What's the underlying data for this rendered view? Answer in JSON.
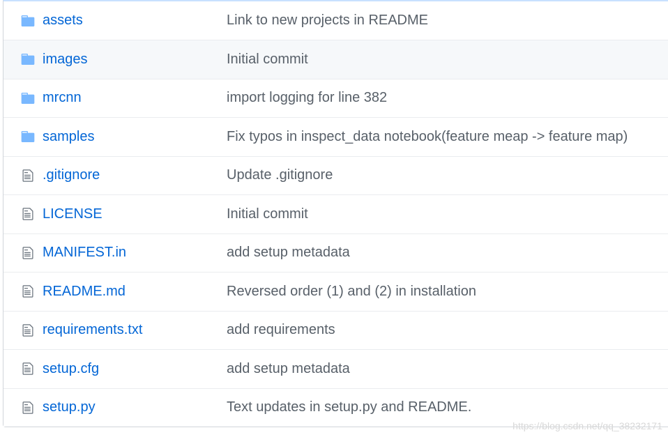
{
  "files": [
    {
      "type": "dir",
      "icon": "folder-icon",
      "name": "assets",
      "message": "Link to new projects in README"
    },
    {
      "type": "dir",
      "icon": "folder-icon",
      "name": "images",
      "message": "Initial commit"
    },
    {
      "type": "dir",
      "icon": "folder-icon",
      "name": "mrcnn",
      "message": "import logging for line 382"
    },
    {
      "type": "dir",
      "icon": "folder-icon",
      "name": "samples",
      "message": "Fix typos in inspect_data notebook(feature meap -> feature map)"
    },
    {
      "type": "file",
      "icon": "file-icon",
      "name": ".gitignore",
      "message": "Update .gitignore"
    },
    {
      "type": "file",
      "icon": "file-icon",
      "name": "LICENSE",
      "message": "Initial commit"
    },
    {
      "type": "file",
      "icon": "file-icon",
      "name": "MANIFEST.in",
      "message": "add setup metadata"
    },
    {
      "type": "file",
      "icon": "file-icon",
      "name": "README.md",
      "message": "Reversed order (1) and (2) in installation"
    },
    {
      "type": "file",
      "icon": "file-icon",
      "name": "requirements.txt",
      "message": "add requirements"
    },
    {
      "type": "file",
      "icon": "file-icon",
      "name": "setup.cfg",
      "message": "add setup metadata"
    },
    {
      "type": "file",
      "icon": "file-icon",
      "name": "setup.py",
      "message": "Text updates in setup.py and README."
    }
  ],
  "hovered_row": "images",
  "watermark": "https://blog.csdn.net/qq_38232171",
  "colors": {
    "link": "#0366d6",
    "message": "#586069",
    "folder_icon": "#79b8ff",
    "file_icon": "#6a737d",
    "hover_bg": "#f6f8fa"
  }
}
